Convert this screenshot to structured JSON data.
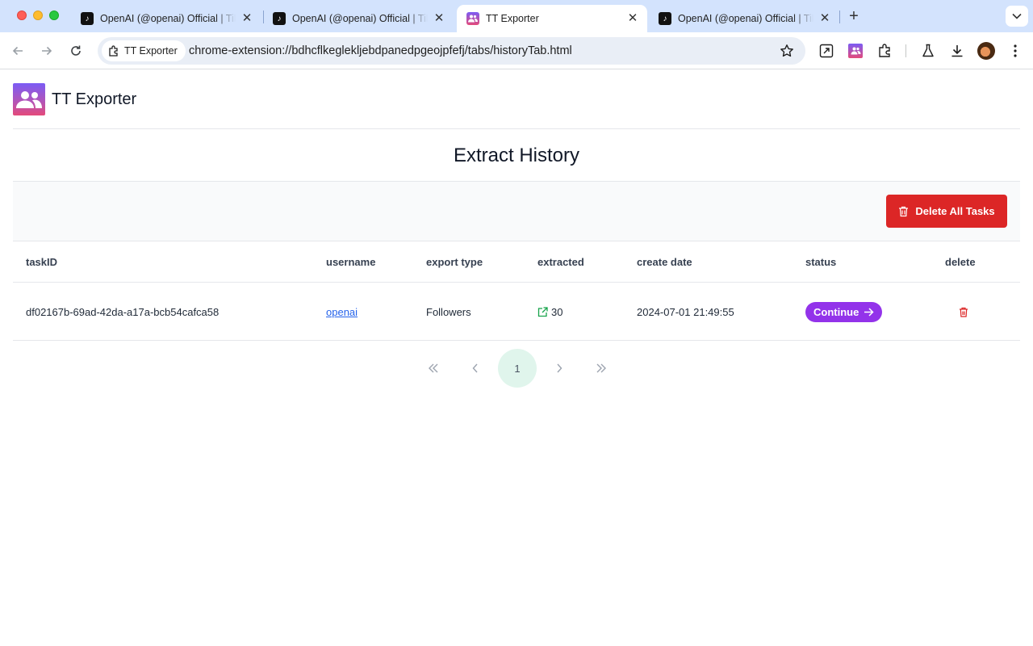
{
  "browser": {
    "tabs": [
      {
        "title": "OpenAI (@openai) Official | TikTok",
        "favicon": "tiktok-icon",
        "active": false
      },
      {
        "title": "OpenAI (@openai) Official | TikTok",
        "favicon": "tiktok-icon",
        "active": false
      },
      {
        "title": "TT Exporter",
        "favicon": "tt-exporter-icon",
        "active": true
      },
      {
        "title": "OpenAI (@openai) Official | TikTok",
        "favicon": "tiktok-icon",
        "active": false
      }
    ],
    "site_chip": "TT Exporter",
    "url": "chrome-extension://bdhcflkeglekljebdpanedpgeojpfefj/tabs/historyTab.html"
  },
  "app": {
    "name": "TT Exporter",
    "page_title": "Extract History",
    "delete_all_label": "Delete All Tasks",
    "accent_colors": {
      "danger": "#dc2626",
      "primary": "#9333ea",
      "link": "#2563eb",
      "success": "#16a34a"
    }
  },
  "table": {
    "headers": {
      "task_id": "taskID",
      "username": "username",
      "export_type": "export type",
      "extracted": "extracted",
      "create_date": "create date",
      "status": "status",
      "delete": "delete"
    },
    "rows": [
      {
        "task_id": "df02167b-69ad-42da-a17a-bcb54cafca58",
        "username": "openai",
        "export_type": "Followers",
        "extracted": "30",
        "create_date": "2024-07-01 21:49:55",
        "status_action": "Continue"
      }
    ]
  },
  "pagination": {
    "current_page": "1",
    "controls": [
      "first-page",
      "prev-page",
      "next-page",
      "last-page"
    ]
  }
}
